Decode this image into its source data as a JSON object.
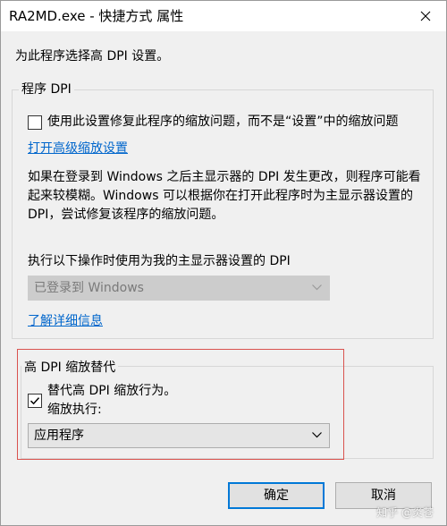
{
  "window": {
    "title": "RA2MD.exe - 快捷方式 属性",
    "close_icon": "close-icon"
  },
  "intro": "为此程序选择高 DPI 设置。",
  "program_dpi": {
    "legend": "程序 DPI",
    "checkbox_label": "使用此设置修复此程序的缩放问题，而不是“设置”中的缩放问题",
    "checkbox_checked": false,
    "advanced_link": "打开高级缩放设置",
    "description": "如果在登录到 Windows 之后主显示器的 DPI 发生更改，则程序可能看起来较模糊。Windows 可以根据你在打开此程序时为主显示器设置的 DPI，尝试修复该程序的缩放问题。",
    "perform_label": "执行以下操作时使用为我的主显示器设置的 DPI",
    "dropdown_value": "已登录到 Windows",
    "learn_more_link": "了解详细信息"
  },
  "override": {
    "legend": "高 DPI 缩放替代",
    "checkbox_label": "替代高 DPI 缩放行为。",
    "checkbox_checked": true,
    "scaling_label": "缩放执行:",
    "dropdown_value": "应用程序",
    "highlight_color": "#d9534f"
  },
  "buttons": {
    "ok": "确定",
    "cancel": "取消"
  },
  "watermark": "知乎 @炎苍"
}
